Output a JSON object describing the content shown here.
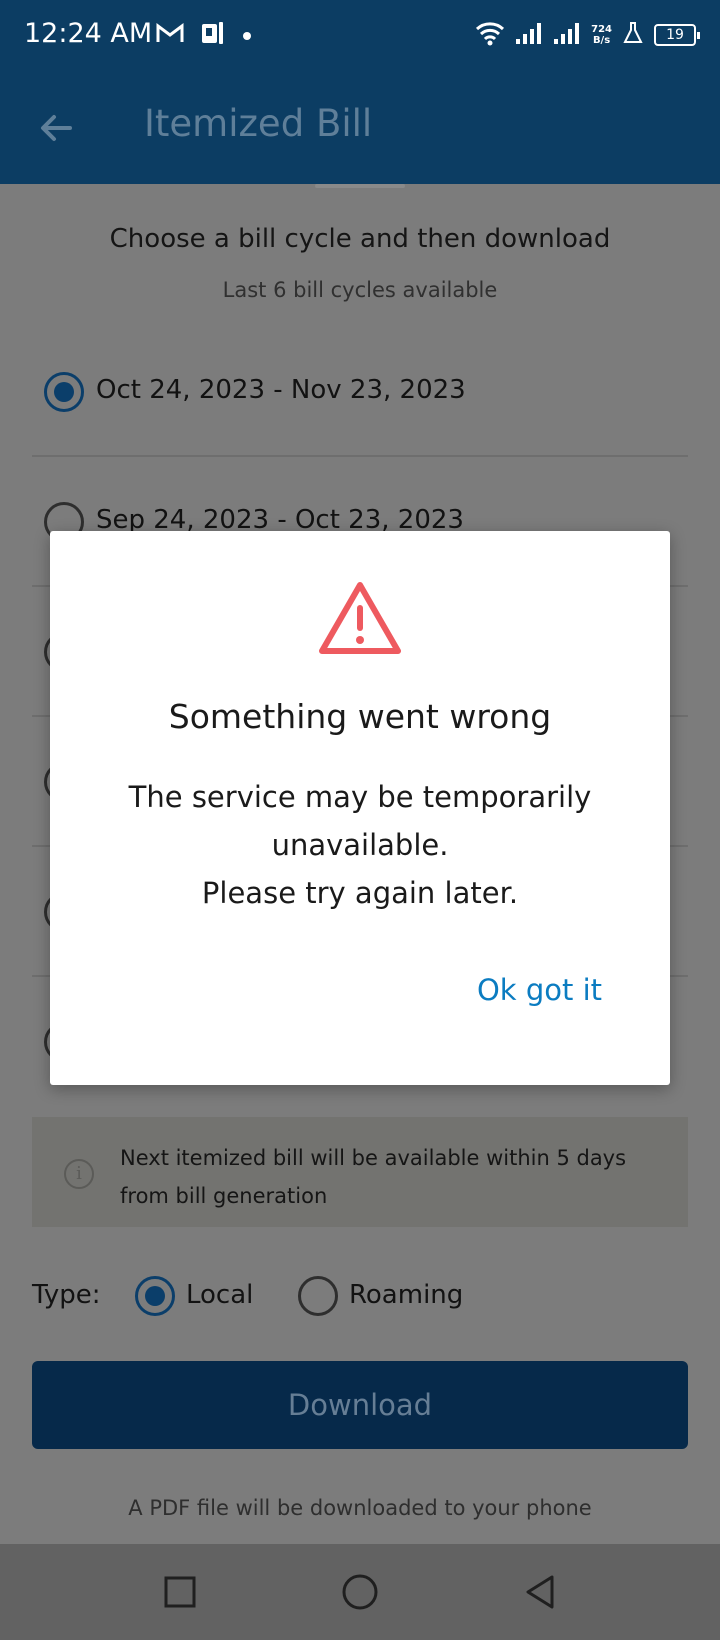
{
  "status_bar": {
    "time": "12:24 AM",
    "net_speed_value": "724",
    "net_speed_unit": "B/s",
    "battery": "19",
    "icons": [
      "gmail-icon",
      "app-notification-icon",
      "dot-icon",
      "wifi-icon",
      "signal-icon",
      "signal-icon",
      "flask-icon",
      "battery-icon"
    ]
  },
  "app_bar": {
    "back_icon": "arrow-left-icon",
    "title": "Itemized Bill"
  },
  "page": {
    "heading": "Choose a bill cycle and then download",
    "subheading": "Last 6 bill cycles available",
    "cycles": [
      {
        "label": "Oct 24, 2023 - Nov 23, 2023",
        "selected": true
      },
      {
        "label": "Sep 24, 2023 - Oct 23, 2023",
        "selected": false
      }
    ],
    "info_text": "Next itemized bill will be available within 5 days from bill generation",
    "type_label": "Type:",
    "type_options": [
      {
        "label": "Local",
        "selected": true
      },
      {
        "label": "Roaming",
        "selected": false
      }
    ],
    "download_label": "Download",
    "pdf_note": "A PDF file will be downloaded to your phone"
  },
  "dialog": {
    "icon": "warning-triangle-icon",
    "icon_color": "#ee5a5f",
    "title": "Something went wrong",
    "message_line1": "The service may be temporarily unavailable.",
    "message_line2": "Please try again later.",
    "ok_label": "Ok got it",
    "ok_color": "#0b7cc1"
  },
  "nav_bar": {
    "buttons": [
      "recents-square-icon",
      "home-circle-icon",
      "back-triangle-icon"
    ]
  }
}
